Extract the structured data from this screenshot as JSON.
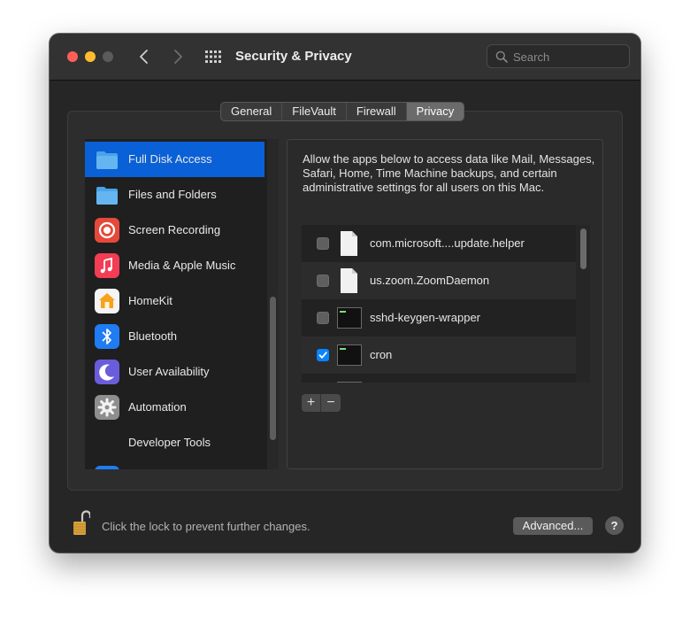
{
  "window": {
    "title": "Security & Privacy",
    "search_placeholder": "Search"
  },
  "tabs": [
    {
      "label": "General",
      "active": false
    },
    {
      "label": "FileVault",
      "active": false
    },
    {
      "label": "Firewall",
      "active": false
    },
    {
      "label": "Privacy",
      "active": true
    }
  ],
  "sidebar": {
    "items": [
      {
        "label": "Full Disk Access",
        "icon": "folder-icon",
        "selected": true
      },
      {
        "label": "Files and Folders",
        "icon": "folder-icon",
        "selected": false
      },
      {
        "label": "Screen Recording",
        "icon": "screen-recording-icon",
        "selected": false
      },
      {
        "label": "Media & Apple Music",
        "icon": "music-icon",
        "selected": false
      },
      {
        "label": "HomeKit",
        "icon": "home-icon",
        "selected": false
      },
      {
        "label": "Bluetooth",
        "icon": "bluetooth-icon",
        "selected": false
      },
      {
        "label": "User Availability",
        "icon": "moon-icon",
        "selected": false
      },
      {
        "label": "Automation",
        "icon": "gear-icon",
        "selected": false
      },
      {
        "label": "Developer Tools",
        "icon": "",
        "selected": false
      }
    ]
  },
  "content": {
    "description": "Allow the apps below to access data like Mail, Messages, Safari, Home, Time Machine backups, and certain administrative settings for all users on this Mac.",
    "apps": [
      {
        "label": "com.microsoft....update.helper",
        "icon": "document-icon",
        "checked": false
      },
      {
        "label": "us.zoom.ZoomDaemon",
        "icon": "document-icon",
        "checked": false
      },
      {
        "label": "sshd-keygen-wrapper",
        "icon": "terminal-icon",
        "checked": false
      },
      {
        "label": "cron",
        "icon": "terminal-icon",
        "checked": true
      }
    ],
    "add_label": "+",
    "remove_label": "−"
  },
  "footer": {
    "lock_text": "Click the lock to prevent further changes.",
    "advanced_label": "Advanced...",
    "help_label": "?"
  },
  "colors": {
    "accent": "#0a60d6",
    "checkbox": "#0a84ff"
  }
}
